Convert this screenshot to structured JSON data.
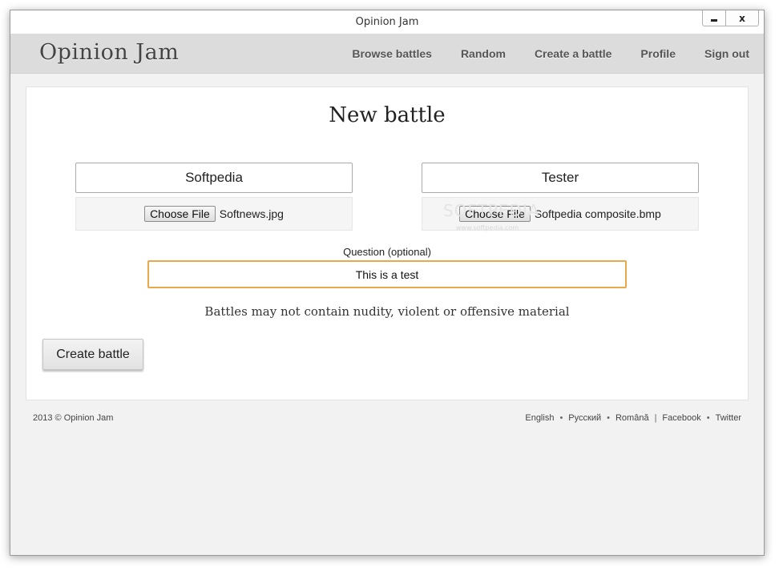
{
  "window": {
    "title": "Opinion Jam",
    "minimize_label": "",
    "close_label": "x"
  },
  "navbar": {
    "brand": "Opinion Jam",
    "links": [
      "Browse battles",
      "Random",
      "Create a battle",
      "Profile",
      "Sign out"
    ]
  },
  "form": {
    "heading": "New battle",
    "contenders": [
      {
        "name": "Softpedia",
        "file_button": "Choose File",
        "file_name": "Softnews.jpg"
      },
      {
        "name": "Tester",
        "file_button": "Choose File",
        "file_name": "Softpedia composite.bmp"
      }
    ],
    "question_label": "Question (optional)",
    "question_value": "This is a test",
    "notice": "Battles may not contain nudity, violent or offensive material",
    "submit_label": "Create battle",
    "watermark": "SOFTPEDIA",
    "watermark_url": "www.softpedia.com"
  },
  "footer": {
    "copyright": "2013 ©  Opinion Jam",
    "languages": [
      "English",
      "Русский",
      "Română"
    ],
    "social": [
      "Facebook",
      "Twitter"
    ],
    "bullet": "•",
    "divider": "|"
  },
  "colors": {
    "navbar_bg": "#dcdcdc",
    "focus_border": "#e8a94b",
    "page_bg": "#f2f2f2"
  }
}
